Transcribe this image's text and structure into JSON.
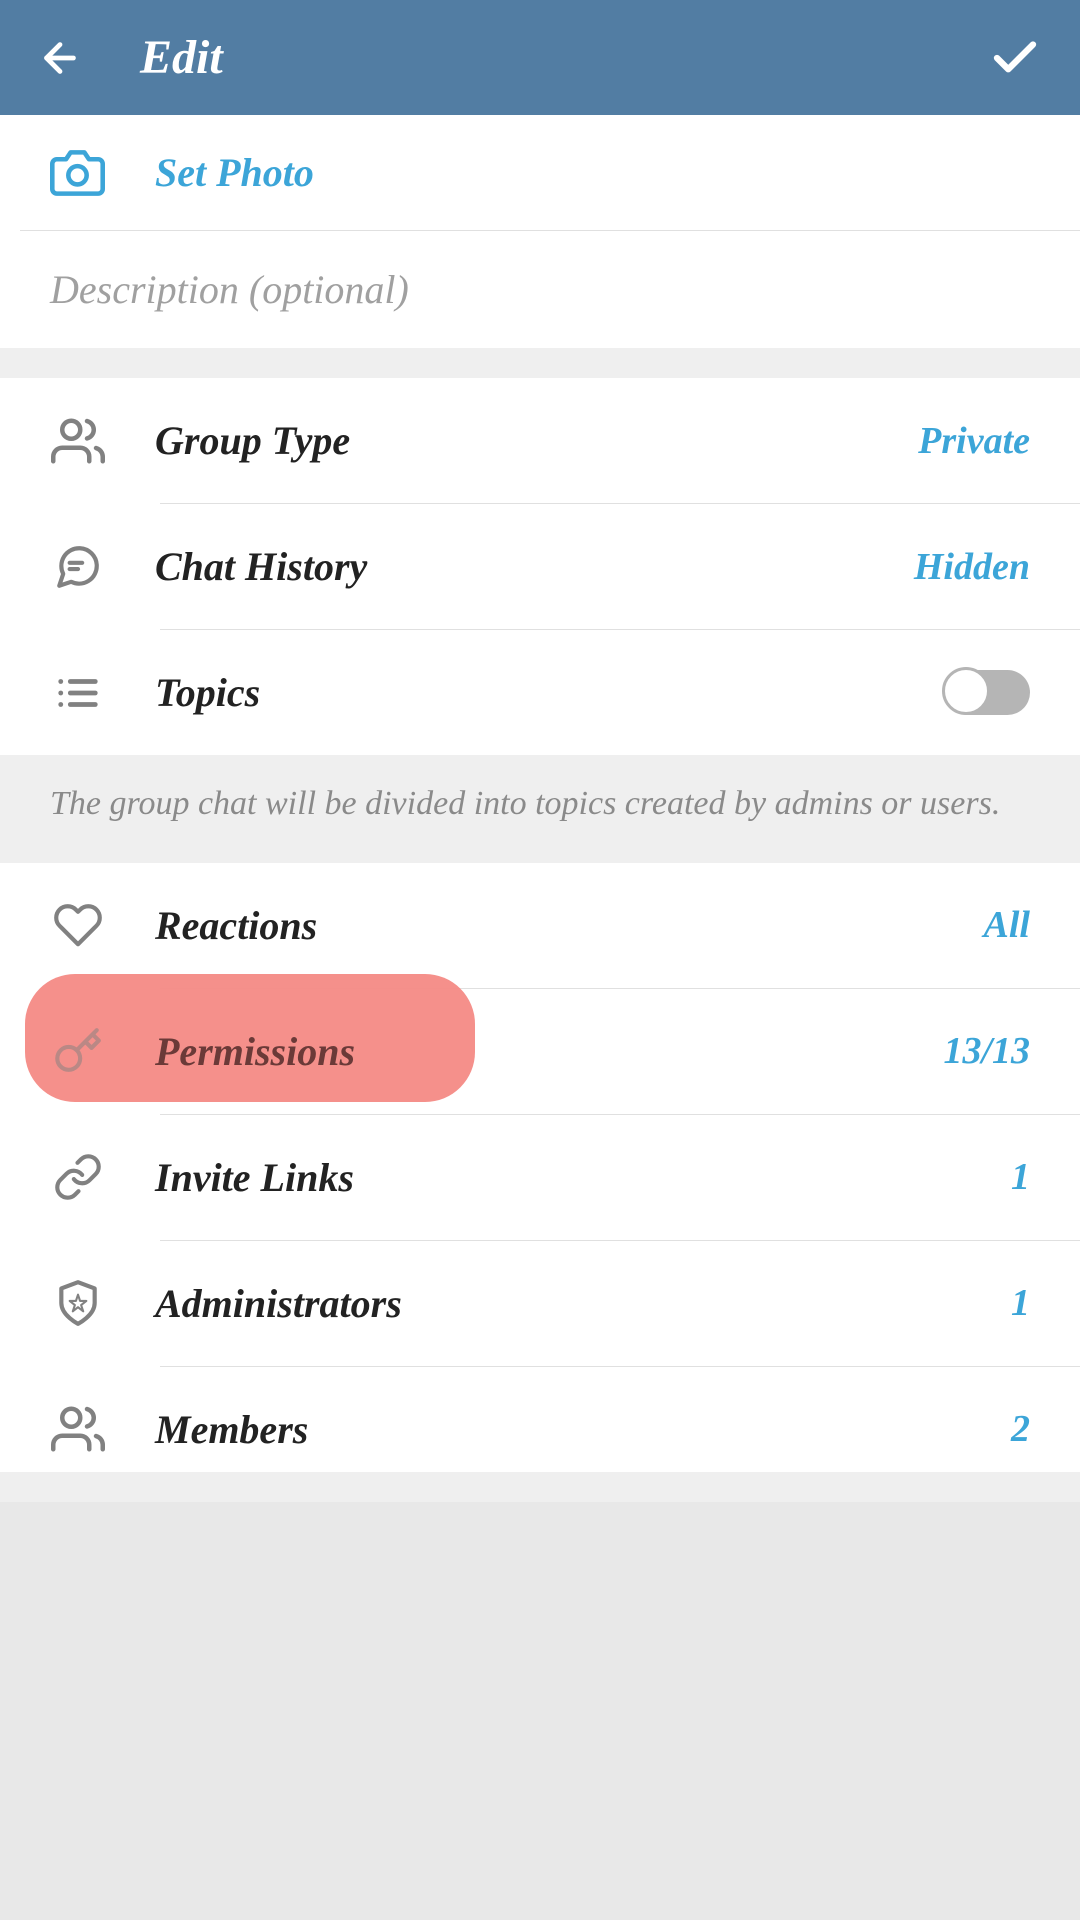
{
  "header": {
    "title": "Edit"
  },
  "setPhoto": {
    "label": "Set Photo"
  },
  "description": {
    "placeholder": "Description (optional)"
  },
  "groupType": {
    "label": "Group Type",
    "value": "Private"
  },
  "chatHistory": {
    "label": "Chat History",
    "value": "Hidden"
  },
  "topics": {
    "label": "Topics",
    "info": "The group chat will be divided into topics created by admins or users."
  },
  "reactions": {
    "label": "Reactions",
    "value": "All"
  },
  "permissions": {
    "label": "Permissions",
    "value": "13/13"
  },
  "inviteLinks": {
    "label": "Invite Links",
    "value": "1"
  },
  "administrators": {
    "label": "Administrators",
    "value": "1"
  },
  "members": {
    "label": "Members",
    "value": "2"
  }
}
